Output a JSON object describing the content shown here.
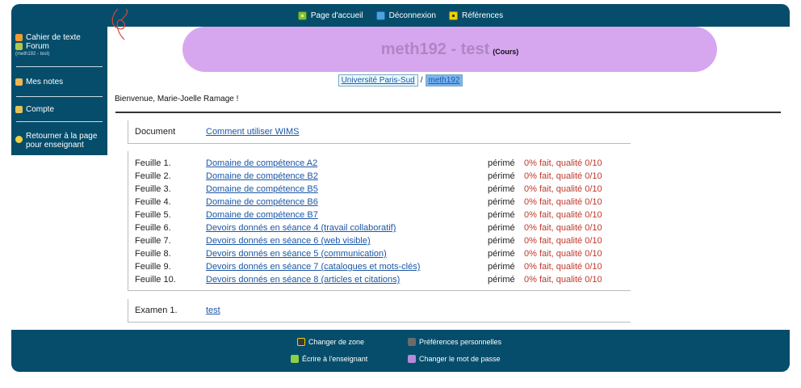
{
  "topnav": {
    "home": "Page d'accueil",
    "logout": "Déconnexion",
    "refs": "Références"
  },
  "sidebar": {
    "cahier": "Cahier de texte",
    "forum": "Forum",
    "forum_sub": "(meth192 - test)",
    "notes": "Mes notes",
    "compte": "Compte",
    "retour1": "Retourner à la page",
    "retour2": "pour enseignant"
  },
  "title": {
    "main": "meth192 - test",
    "sub": "(Cours)"
  },
  "breadcrumb": {
    "first": "Université Paris-Sud",
    "sep": "/",
    "second": "meth192"
  },
  "welcome": "Bienvenue, Marie-Joelle Ramage !",
  "document": {
    "label": "Document",
    "link": "Comment utiliser WIMS"
  },
  "feuilles": [
    {
      "label": "Feuille 1.",
      "title": "Domaine de compétence A2",
      "status": "périmé",
      "score": "0% fait, qualité 0/10"
    },
    {
      "label": "Feuille 2.",
      "title": "Domaine de compétence B2",
      "status": "périmé",
      "score": "0% fait, qualité 0/10"
    },
    {
      "label": "Feuille 3.",
      "title": "Domaine de compétence B5",
      "status": "périmé",
      "score": "0% fait, qualité 0/10"
    },
    {
      "label": "Feuille 4.",
      "title": "Domaine de compétence B6",
      "status": "périmé",
      "score": "0% fait, qualité 0/10"
    },
    {
      "label": "Feuille 5.",
      "title": "Domaine de compétence B7",
      "status": "périmé",
      "score": "0% fait, qualité 0/10"
    },
    {
      "label": "Feuille 6.",
      "title": "Devoirs donnés en séance 4 (travail collaboratif)",
      "status": "périmé",
      "score": "0% fait, qualité 0/10"
    },
    {
      "label": "Feuille 7.",
      "title": "Devoirs donnés en séance 6 (web visible)",
      "status": "périmé",
      "score": "0% fait, qualité 0/10"
    },
    {
      "label": "Feuille 8.",
      "title": "Devoirs donnés en séance 5 (communication)",
      "status": "périmé",
      "score": "0% fait, qualité 0/10"
    },
    {
      "label": "Feuille 9.",
      "title": "Devoirs donnés en séance 7 (catalogues et mots-clés)",
      "status": "périmé",
      "score": "0% fait, qualité 0/10"
    },
    {
      "label": "Feuille 10.",
      "title": "Devoirs donnés en séance 8 (articles et citations)",
      "status": "périmé",
      "score": "0% fait, qualité 0/10"
    }
  ],
  "exam": {
    "label": "Examen 1.",
    "link": "test"
  },
  "footer": {
    "zone": "Changer de zone",
    "prefs": "Préférences personnelles",
    "write": "Écrire à l'enseignant",
    "password": "Changer le mot de passe"
  }
}
